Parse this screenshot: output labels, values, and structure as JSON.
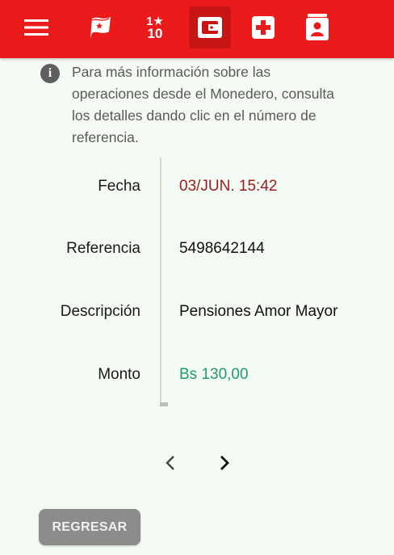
{
  "nav": {
    "icons": [
      "menu-icon",
      "flag-icon",
      "ranking-icon",
      "wallet-icon",
      "health-cross-icon",
      "profile-card-icon"
    ],
    "active": "wallet-icon",
    "ranking_text_top": "1★",
    "ranking_text_bottom": "10"
  },
  "info": {
    "text": "Para más información sobre las operaciones desde el Monedero, consulta los detalles dando clic en el número de referencia."
  },
  "details": {
    "fecha_label": "Fecha",
    "fecha_value": "03/JUN. 15:42",
    "referencia_label": "Referencia",
    "referencia_value": "5498642144",
    "descripcion_label": "Descripción",
    "descripcion_value": "Pensiones Amor Mayor",
    "monto_label": "Monto",
    "monto_value": "Bs 130,00"
  },
  "pager": {
    "prev_icon": "chevron-left-icon",
    "next_icon": "chevron-right-icon"
  },
  "back_button": "REGRESAR",
  "colors": {
    "header": "#ec1b1b",
    "background": "#f4fbf4",
    "date_value": "#9b1c1c",
    "amount_value": "#1f9b6c",
    "button": "#8c8c8c"
  }
}
